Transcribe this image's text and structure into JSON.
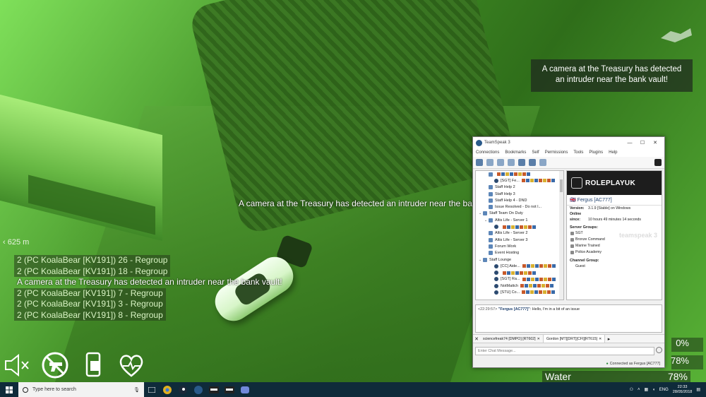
{
  "hud": {
    "distance": "625 m",
    "center_message": "A camera at the Treasury has detected an intruder near the bank vault!",
    "notification": "A camera at the Treasury has detected an intruder near the bank vault!",
    "chat": [
      {
        "text": "2 (PC KoalaBear [KV191]) 26 - Regroup",
        "kind": "grp"
      },
      {
        "text": "2 (PC KoalaBear [KV191]) 18 - Regroup",
        "kind": "grp"
      },
      {
        "text": "A camera at the Treasury has detected an intruder near the bank vault!",
        "kind": "notice"
      },
      {
        "text": "2 (PC KoalaBear [KV191]) 7 - Regroup",
        "kind": "grp"
      },
      {
        "text": "2 (PC KoalaBear [KV191]) 3 - Regroup",
        "kind": "grp"
      },
      {
        "text": "2 (PC KoalaBear [KV191]) 8 - Regroup",
        "kind": "grp"
      }
    ],
    "stats": {
      "stat1": "0%",
      "stat2": "78%",
      "water_label": "Water",
      "water_value": "78%"
    },
    "status_icons": [
      "speaker-muted-icon",
      "no-weapon-icon",
      "phone-icon",
      "health-heart-icon"
    ]
  },
  "teamspeak": {
    "title": "TeamSpeak 3",
    "menu": [
      "Connections",
      "Bookmarks",
      "Self",
      "Permissions",
      "Tools",
      "Plugins",
      "Help"
    ],
    "tree": [
      {
        "label": "",
        "type": "badges-row",
        "indent": 1
      },
      {
        "label": "[SGT] Fe...",
        "type": "user",
        "indent": 2
      },
      {
        "label": "Staff Help 2",
        "type": "channel",
        "indent": 1
      },
      {
        "label": "Staff Help 3",
        "type": "channel",
        "indent": 1
      },
      {
        "label": "Staff Help 4 - DND",
        "type": "channel",
        "indent": 1
      },
      {
        "label": "Issue Resolved - Do not l...",
        "type": "channel",
        "indent": 1
      },
      {
        "label": "Staff Team On Duty",
        "type": "channel",
        "indent": 0,
        "expanded": true
      },
      {
        "label": "Altis Life - Server 1",
        "type": "channel",
        "indent": 1,
        "expanded": true
      },
      {
        "label": "",
        "type": "user",
        "indent": 2
      },
      {
        "label": "Altis Life - Server 2",
        "type": "channel",
        "indent": 1
      },
      {
        "label": "Altis Life - Server 3",
        "type": "channel",
        "indent": 1
      },
      {
        "label": "Forum Work",
        "type": "channel",
        "indent": 1
      },
      {
        "label": "Event Hosting",
        "type": "channel",
        "indent": 1
      },
      {
        "label": "Staff Lounge",
        "type": "channel",
        "indent": 0,
        "expanded": true
      },
      {
        "label": "[CC] Aide...",
        "type": "user",
        "indent": 2
      },
      {
        "label": "",
        "type": "user",
        "indent": 2
      },
      {
        "label": "[SGT] Ra...",
        "type": "user",
        "indent": 2
      },
      {
        "label": "NotMattch",
        "type": "user",
        "indent": 2
      },
      {
        "label": "[STU] Co...",
        "type": "user",
        "indent": 2
      }
    ],
    "info": {
      "brand": "ROLEPLAYUK",
      "nickname": "Fergus [AC777]",
      "version_label": "Version:",
      "version": "3.1.9 [Stable] on Windows",
      "online_label": "Online since:",
      "online": "10 hours 49 minutes 14 seconds",
      "server_groups_label": "Server Groups:",
      "server_groups": [
        "SGT",
        "Bronze Command",
        "Marine Trained",
        "Police Academy"
      ],
      "channel_group_label": "Channel Group:",
      "channel_group": "Guest",
      "watermark": "teamspeak 3"
    },
    "chat": {
      "time": "<22:29:57>",
      "who": "\"Fergus [AC777]\"",
      "msg": ": Hello, I'm in a bit of an issue"
    },
    "tabs": [
      "sciencefreak74 [DMPO] [RT602]",
      "Gordon [MT][DRT][CFI][RT615]"
    ],
    "input_placeholder": "Enter Chat Message...",
    "status": "Connected as Fergus [AC777]"
  },
  "taskbar": {
    "search_placeholder": "Type here to search",
    "tray_lang": "ENG",
    "time": "22:33",
    "date": "28/05/2018"
  }
}
